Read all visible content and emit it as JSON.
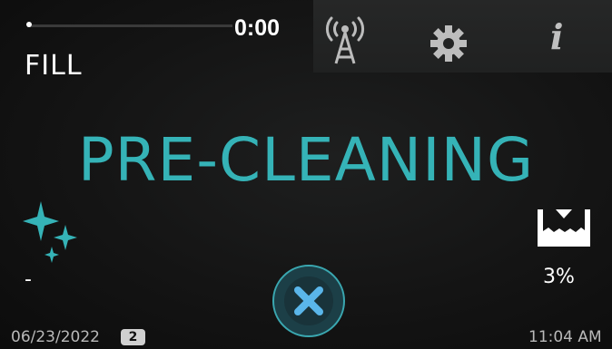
{
  "header": {
    "timer": "0:00",
    "mode_label": "FILL",
    "progress_fraction": 0.0,
    "icons": [
      "antenna-icon",
      "gear-icon",
      "info-icon"
    ],
    "info_glyph": "i"
  },
  "main": {
    "status_title": "PRE-CLEANING",
    "status_color": "#35b3b7",
    "left_value": "-",
    "level_percent": "3%"
  },
  "footer": {
    "date": "06/23/2022",
    "badge_count": "2",
    "time": "11:04 AM"
  },
  "colors": {
    "accent": "#35b3b7",
    "cancel_x": "#5ab6ea"
  }
}
